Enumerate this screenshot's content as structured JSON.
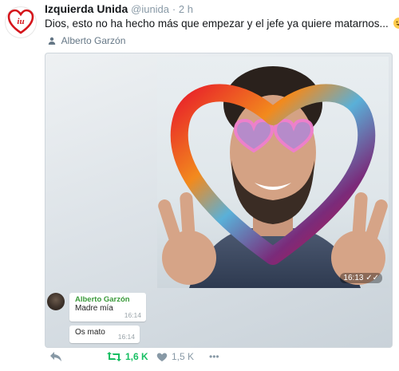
{
  "tweet": {
    "author_name": "Izquierda Unida",
    "author_handle": "@iunida",
    "time": "· 2 h",
    "text": "Dios, esto no ha hecho más que empezar y el jefe ya quiere matarnos...",
    "retweeted_by": "Alberto Garzón",
    "avatar_logo_text": "iu"
  },
  "media": {
    "photo_time": "16:13",
    "chat": [
      {
        "sender": "Alberto Garzón",
        "text": "Madre mía",
        "time": "16:14"
      },
      {
        "text": "Os mato",
        "time": "16:14"
      }
    ]
  },
  "actions": {
    "retweet_count": "1,6 K",
    "like_count": "1,5 K",
    "more_label": "•••"
  },
  "colors": {
    "retweet_green": "#17bf63",
    "iu_red": "#d5141b",
    "chat_sender_green": "#3a9a3a"
  },
  "icons": [
    "reply-icon",
    "retweet-icon",
    "heart-icon",
    "more-icon",
    "user-icon",
    "grinning-sweat-emoji",
    "double-check-icon"
  ]
}
